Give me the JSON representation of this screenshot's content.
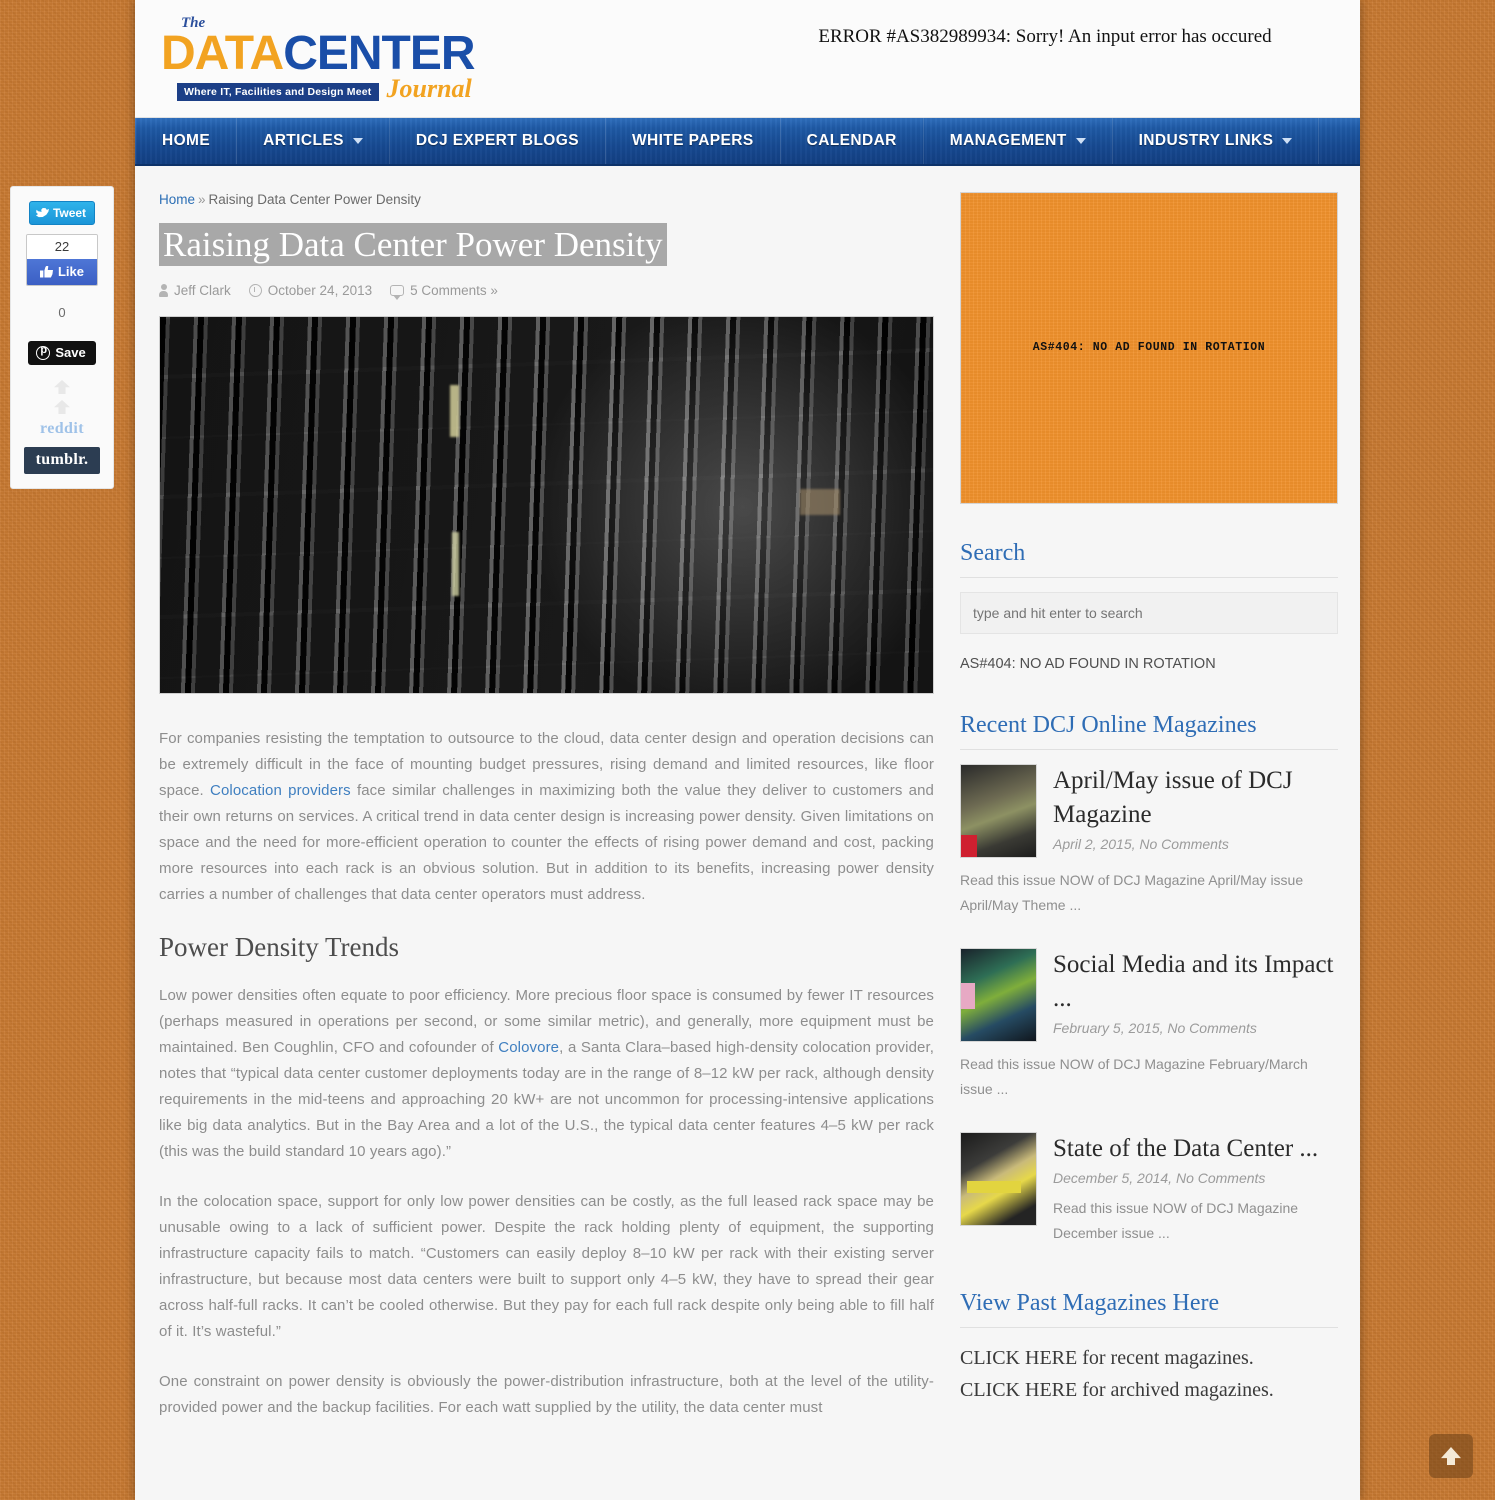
{
  "site": {
    "logo": {
      "the": "The",
      "data": "DATA",
      "center": "CENTER",
      "tagline": "Where IT, Facilities and Design Meet",
      "journal": "Journal"
    },
    "error_banner": "ERROR #AS382989934: Sorry! An input error has occured"
  },
  "nav": {
    "items": [
      {
        "label": "HOME",
        "has_caret": false
      },
      {
        "label": "ARTICLES",
        "has_caret": true
      },
      {
        "label": "DCJ EXPERT BLOGS",
        "has_caret": false
      },
      {
        "label": "WHITE PAPERS",
        "has_caret": false
      },
      {
        "label": "CALENDAR",
        "has_caret": false
      },
      {
        "label": "MANAGEMENT",
        "has_caret": true
      },
      {
        "label": "INDUSTRY LINKS",
        "has_caret": true
      }
    ]
  },
  "breadcrumb": {
    "home": "Home",
    "separator": "»",
    "current": "Raising Data Center Power Density"
  },
  "article": {
    "title": "Raising Data Center Power Density",
    "author": "Jeff Clark",
    "date": "October 24, 2013",
    "comments": "5 Comments »",
    "paragraph_1_pre": "For companies resisting the temptation to outsource to the cloud, data center design and operation decisions can be extremely difficult in the face of mounting budget pressures, rising demand and limited resources, like floor space. ",
    "paragraph_1_link": "Colocation providers",
    "paragraph_1_post": " face similar challenges in maximizing both the value they deliver to customers and their own returns on services. A critical trend in data center design is increasing power density. Given limitations on space and the need for more-efficient operation to counter the effects of rising power demand and cost, packing more resources into each rack is an obvious solution. But in addition to its benefits, increasing power density carries a number of challenges that data center operators must address.",
    "section_heading": "Power Density Trends",
    "paragraph_2_pre": "Low power densities often equate to poor efficiency. More precious floor space is consumed by fewer IT resources (perhaps measured in operations per second, or some similar metric), and generally, more equipment must be maintained. Ben Coughlin, CFO and cofounder of ",
    "paragraph_2_link": "Colovore",
    "paragraph_2_post": ", a Santa Clara–based high-density colocation provider, notes that “typical data center customer deployments today are in the range of 8–12 kW per rack, although density requirements in the mid-teens and approaching 20 kW+ are not uncommon for processing-intensive applications like big data analytics. But in the Bay Area and a lot of the U.S., the typical data center features 4–5 kW per rack (this was the build standard 10 years ago).”",
    "paragraph_3": "In the colocation space, support for only low power densities can be costly, as the full leased rack space may be unusable owing to a lack of sufficient power. Despite the rack holding plenty of equipment, the supporting infrastructure capacity fails to match. “Customers can easily deploy 8–10 kW per rack with their existing server infrastructure, but because most data centers were built to support only 4–5 kW, they have to spread their gear across half-full racks. It can’t be cooled otherwise. But they pay for each full rack despite only being able to fill half of it. It’s wasteful.”",
    "paragraph_4": "One constraint on power density is obviously the power-distribution infrastructure, both at the level of the utility-provided power and the backup facilities. For each watt supplied by the utility, the data center must"
  },
  "social": {
    "tweet_label": "Tweet",
    "facebook_count": "22",
    "facebook_label": "Like",
    "pinterest_count": "0",
    "pinterest_label": "Save",
    "reddit_label": "reddit",
    "tumblr_label": "tumblr."
  },
  "sidebar": {
    "ad_box_text": "AS#404: NO AD FOUND IN ROTATION",
    "search_heading": "Search",
    "search_placeholder": "type and hit enter to search",
    "search_note": "AS#404: NO AD FOUND IN ROTATION",
    "magazines_heading": "Recent DCJ Online Magazines",
    "magazines": [
      {
        "title": "April/May issue of DCJ Magazine",
        "date": "April 2, 2015, No Comments",
        "excerpt": "Read this issue NOW of DCJ Magazine April/May issue April/May Theme ..."
      },
      {
        "title": "Social Media and its Impact ...",
        "date": "February 5, 2015, No Comments",
        "excerpt": "Read this issue NOW of DCJ Magazine February/March issue ..."
      },
      {
        "title": "State of the Data Center ...",
        "date": "December 5, 2014, No Comments",
        "excerpt": "Read this issue NOW of DCJ Magazine December issue ..."
      }
    ],
    "past_heading": "View Past Magazines Here",
    "click_recent": "CLICK HERE for recent magazines.",
    "click_archived": "CLICK HERE for archived magazines."
  },
  "colors": {
    "page_background": "#c87a32",
    "nav_blue": "#1f5aa6",
    "accent_orange": "#f0912c",
    "link_blue": "#2f6db5",
    "logo_orange": "#f2a321"
  }
}
